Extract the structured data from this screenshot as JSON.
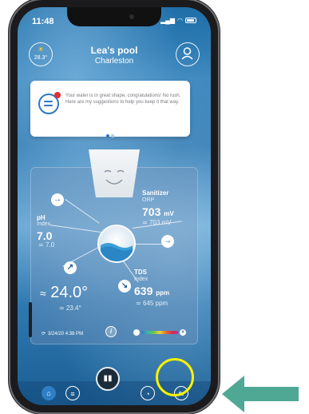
{
  "status_bar": {
    "time": "11:48"
  },
  "header": {
    "pool_name": "Lea's pool",
    "location": "Charleston",
    "weather_temp": "28.3°"
  },
  "message": {
    "text": "Your water is in great shape, congratulations! No rush. Here are my suggestions to help you keep it that way."
  },
  "readings": {
    "ph": {
      "label": "pH",
      "sub": "Index",
      "value": "7.0",
      "target": "7.0",
      "arrow": "→"
    },
    "sanitizer": {
      "label": "Sanitizer",
      "sub": "ORP",
      "value": "703",
      "unit": "mV",
      "target": "703 mV",
      "arrow": "→"
    },
    "tds": {
      "label": "TDS",
      "sub": "Index",
      "value": "639",
      "unit": "ppm",
      "target": "645 ppm",
      "arrow": "↘"
    },
    "temperature": {
      "value": "24.0°",
      "target": "23.4°",
      "arrow": "↗"
    }
  },
  "footer": {
    "timestamp": "3/24/20 4:38 PM",
    "info_label": "i"
  },
  "tab_bar": {
    "items": [
      {
        "icon": "home-icon"
      },
      {
        "icon": "chat-icon"
      },
      {
        "icon": "device-icon"
      },
      {
        "icon": "gauge-icon"
      },
      {
        "icon": "test-strip-icon"
      }
    ]
  },
  "colors": {
    "accent": "#2e78c8",
    "highlight": "#f7f200",
    "arrow": "#4fa894"
  }
}
